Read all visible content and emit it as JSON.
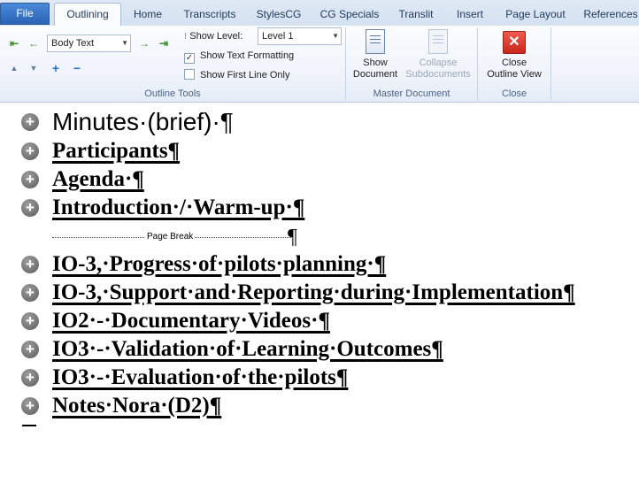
{
  "tabs": [
    {
      "label": "File"
    },
    {
      "label": "Outlining"
    },
    {
      "label": "Home"
    },
    {
      "label": "Transcripts"
    },
    {
      "label": "StylesCG"
    },
    {
      "label": "CG Specials"
    },
    {
      "label": "Translit"
    },
    {
      "label": "Insert"
    },
    {
      "label": "Page Layout"
    },
    {
      "label": "References"
    }
  ],
  "outline_tools": {
    "group_label": "Outline Tools",
    "level_combo_value": "Body Text",
    "show_level_label": "Show Level:",
    "show_level_value": "Level 1",
    "show_text_formatting_label": "Show Text Formatting",
    "show_text_formatting_checked": true,
    "show_first_line_only_label": "Show First Line Only",
    "show_first_line_only_checked": false
  },
  "master_document": {
    "group_label": "Master Document",
    "show_document_label_1": "Show",
    "show_document_label_2": "Document",
    "collapse_label_1": "Collapse",
    "collapse_label_2": "Subdocuments"
  },
  "close_group": {
    "group_label": "Close",
    "close_label_1": "Close",
    "close_label_2": "Outline View"
  },
  "outline": {
    "headings": [
      {
        "text": "Minutes·(brief)·¶",
        "level": 1
      },
      {
        "text": "Participants¶",
        "level": 2
      },
      {
        "text": "Agenda·¶",
        "level": 2
      },
      {
        "text": "Introduction·/·Warm-up·¶",
        "level": 2
      }
    ],
    "page_break_label": "Page Break",
    "page_break_mark": "¶",
    "headings_after_break": [
      {
        "text": "IO-3,·Progress·of·pilots·planning·¶"
      },
      {
        "text": "IO-3,·Support·and·Reporting·during·Implementation¶"
      },
      {
        "text": "IO2·-·Documentary·Videos·¶"
      },
      {
        "text": "IO3·-·Validation·of·Learning·Outcomes¶"
      },
      {
        "text": "IO3·-·Evaluation·of·the·pilots¶"
      },
      {
        "text": "Notes·Nora·(D2)¶"
      }
    ]
  },
  "colors": {
    "file_tab": "#2a64b5",
    "close_icon": "#c9271c",
    "ribbon_label": "#4a6485"
  }
}
